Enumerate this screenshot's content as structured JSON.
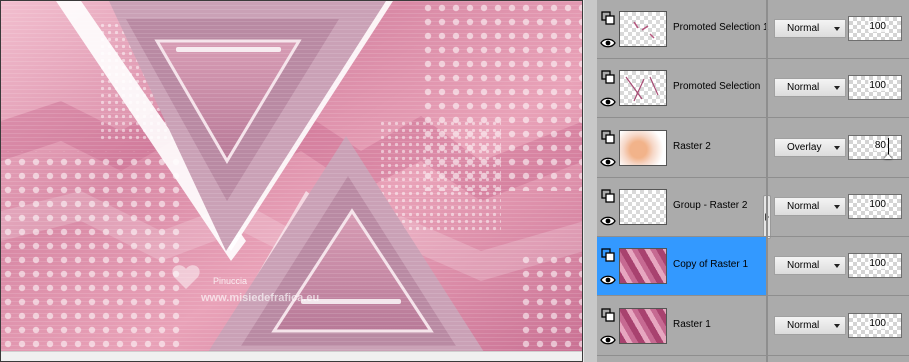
{
  "canvas": {
    "watermark_name": "Pinuccia",
    "watermark_site": "www.misiedefrafica.eu",
    "colors": {
      "base": "#e9a7bd",
      "accent": "#b54f7c",
      "light": "#fbe3ea"
    }
  },
  "layers": [
    {
      "name": "Promoted Selection 1",
      "blend_mode": "Normal",
      "opacity": "100",
      "selected": false,
      "thumb": "transparent-marks"
    },
    {
      "name": "Promoted Selection",
      "blend_mode": "Normal",
      "opacity": "100",
      "selected": false,
      "thumb": "transparent-lines"
    },
    {
      "name": "Raster 2",
      "blend_mode": "Overlay",
      "opacity": "80",
      "selected": false,
      "thumb": "colored-blur"
    },
    {
      "name": "Group - Raster 2",
      "blend_mode": "Normal",
      "opacity": "100",
      "selected": false,
      "thumb": "transparent"
    },
    {
      "name": "Copy of Raster 1",
      "blend_mode": "Normal",
      "opacity": "100",
      "selected": true,
      "thumb": "pink-waves"
    },
    {
      "name": "Raster 1",
      "blend_mode": "Normal",
      "opacity": "100",
      "selected": false,
      "thumb": "pink-waves"
    }
  ],
  "icons": {
    "layer_link": "link-layer-icon",
    "visibility": "eye-icon",
    "dropdown": "chevron-down-icon"
  }
}
